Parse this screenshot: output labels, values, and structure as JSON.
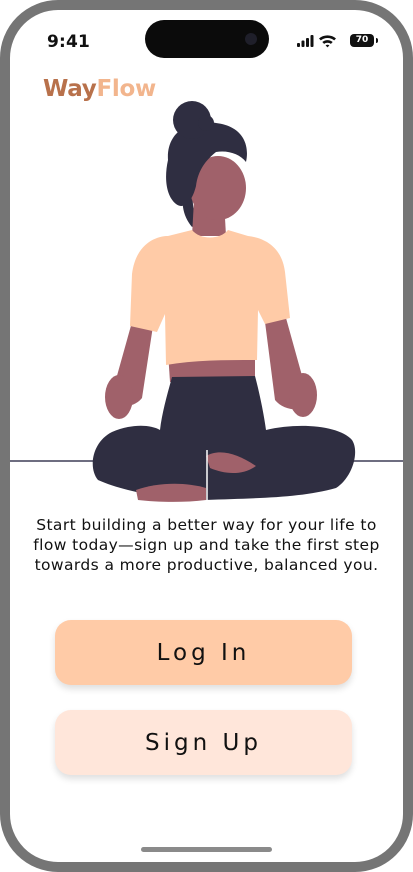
{
  "status_bar": {
    "time": "9:41",
    "battery": "70"
  },
  "app": {
    "logo_part1": "Way",
    "logo_part2": "Flow"
  },
  "illustration": {
    "name": "person-meditating-illustration"
  },
  "main": {
    "tagline": "Start building a better way for your life to flow today—sign up and take the first step towards a more productive, balanced you.",
    "login_label": "Log In",
    "signup_label": "Sign Up"
  },
  "colors": {
    "logo_way": "#b8714b",
    "logo_flow": "#f2b58d",
    "login_button": "#ffcba7",
    "signup_button": "#ffe6da",
    "hair_pants": "#2f2e41",
    "skin": "#a0616a",
    "shirt": "#ffcba7"
  }
}
